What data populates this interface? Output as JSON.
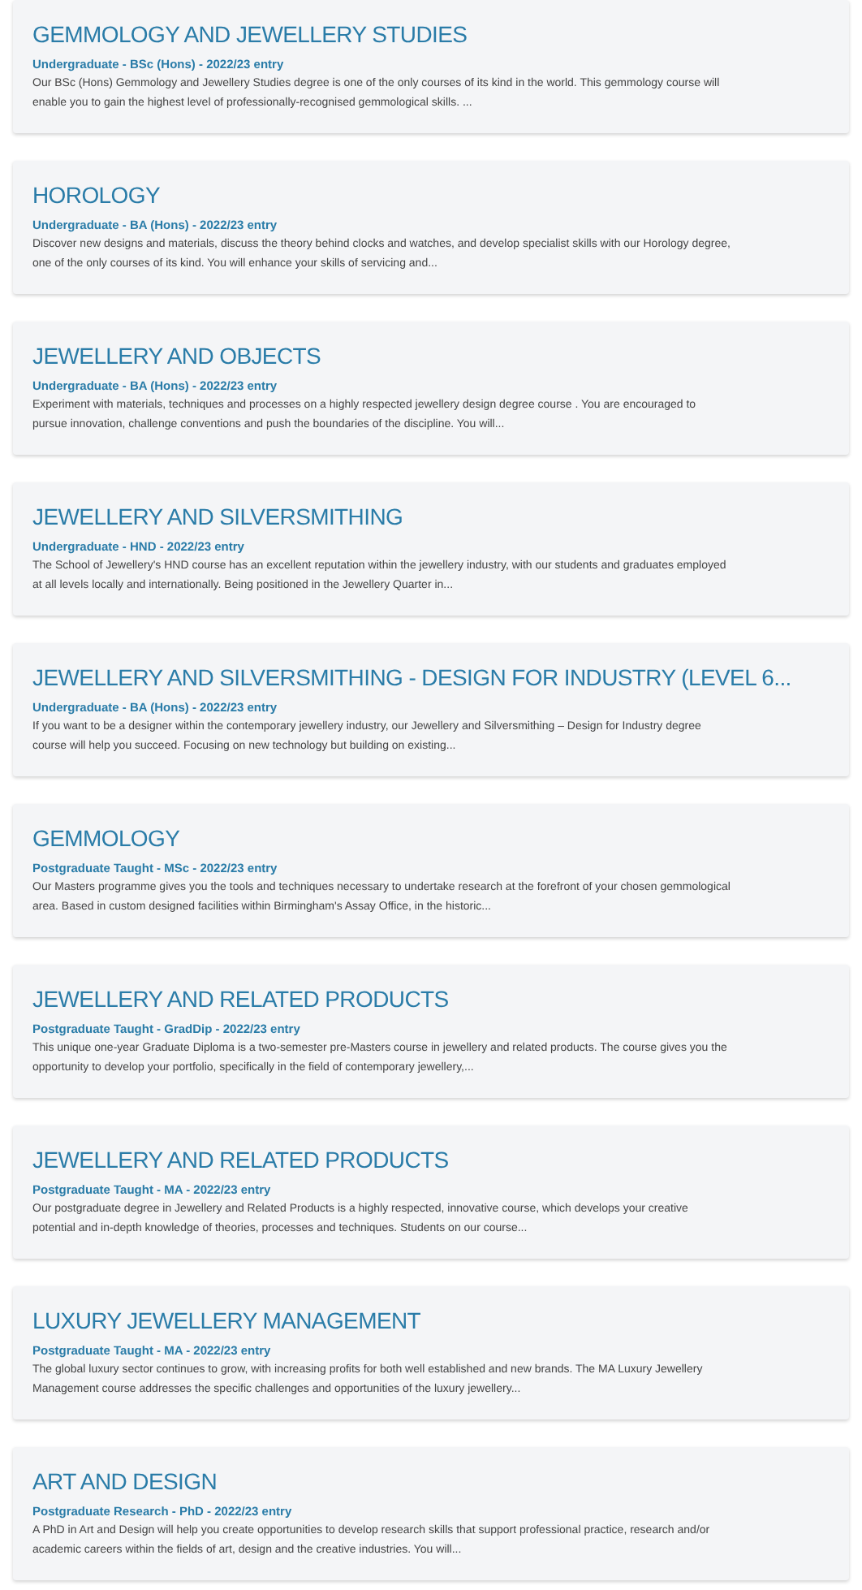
{
  "courses": [
    {
      "title": "GEMMOLOGY AND JEWELLERY STUDIES",
      "meta": "Undergraduate - BSc (Hons) - 2022/23 entry",
      "description": "Our BSc (Hons) Gemmology and Jewellery Studies degree is one of the only courses of its kind in the world. This gemmology course will enable you to gain the highest level of professionally-recognised gemmological skills. ..."
    },
    {
      "title": "HOROLOGY",
      "meta": "Undergraduate - BA (Hons) - 2022/23 entry",
      "description": "Discover new designs and materials, discuss the theory behind clocks and watches, and develop specialist skills with our Horology degree, one of the only courses of its kind. You will enhance your skills of servicing and..."
    },
    {
      "title": "JEWELLERY AND OBJECTS",
      "meta": "Undergraduate - BA (Hons) - 2022/23 entry",
      "description": "Experiment with materials, techniques and processes on a  highly respected jewellery design degree course . You are encouraged to pursue innovation, challenge conventions and push the boundaries of the discipline. You will..."
    },
    {
      "title": "JEWELLERY AND SILVERSMITHING",
      "meta": "Undergraduate - HND - 2022/23 entry",
      "description": "The School of Jewellery's HND course has an excellent reputation within the jewellery industry, with our students and graduates employed at all levels locally and internationally. Being positioned in the Jewellery Quarter in..."
    },
    {
      "title": "JEWELLERY AND SILVERSMITHING - DESIGN FOR INDUSTRY (LEVEL 6...",
      "meta": "Undergraduate - BA (Hons) - 2022/23 entry",
      "description": "If you want to be a designer within the contemporary jewellery industry, our Jewellery and Silversmithing – Design for Industry degree course will help you succeed. Focusing on new technology but building on existing..."
    },
    {
      "title": "GEMMOLOGY",
      "meta": "Postgraduate Taught - MSc - 2022/23 entry",
      "description": "Our Masters programme gives you the tools and techniques necessary to undertake research at the forefront of your chosen gemmological area. Based in custom designed facilities within Birmingham's Assay Office, in the historic..."
    },
    {
      "title": "JEWELLERY AND RELATED PRODUCTS",
      "meta": "Postgraduate Taught - GradDip - 2022/23 entry",
      "description": "This unique one-year Graduate Diploma is a two-semester pre-Masters course in jewellery and related products. The course gives you the opportunity to develop your portfolio, specifically in the field of contemporary jewellery,..."
    },
    {
      "title": "JEWELLERY AND RELATED PRODUCTS",
      "meta": "Postgraduate Taught - MA - 2022/23 entry",
      "description": "Our postgraduate degree in Jewellery and Related Products is a highly respected, innovative course, which develops your creative potential and in-depth knowledge of theories, processes and techniques. Students on our course..."
    },
    {
      "title": "LUXURY JEWELLERY MANAGEMENT",
      "meta": "Postgraduate Taught - MA - 2022/23 entry",
      "description": "The global luxury sector continues to grow, with increasing profits for both well established and new brands. The MA Luxury Jewellery Management course addresses the specific challenges and opportunities of the luxury jewellery..."
    },
    {
      "title": "ART AND DESIGN",
      "meta": "Postgraduate Research - PhD - 2022/23 entry",
      "description": "A PhD in Art and Design will help you create opportunities to develop research skills that support professional practice, research and/or academic careers within the fields of art, design and the creative industries.  You will..."
    }
  ]
}
